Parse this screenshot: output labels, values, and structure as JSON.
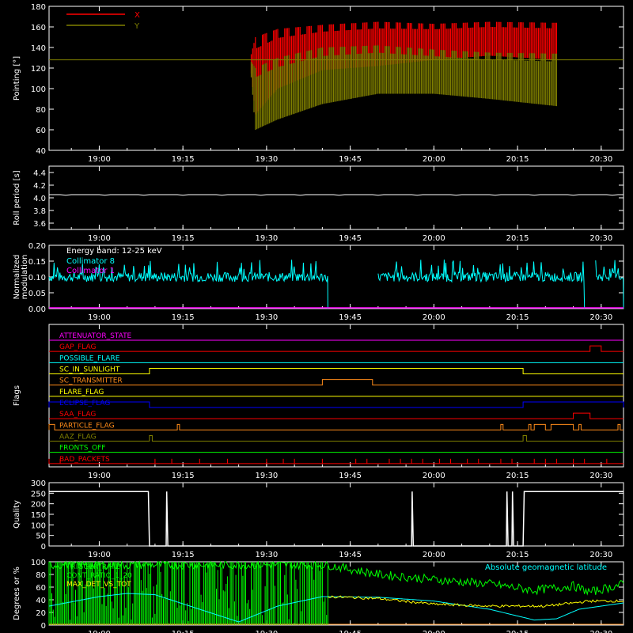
{
  "colors": {
    "bg": "#000000",
    "axis": "#ffffff",
    "red": "#ff0000",
    "olive": "#808000",
    "cyan": "#00ffff",
    "magenta": "#ff00ff",
    "orange": "#ff8c1a",
    "yellow": "#ffff00",
    "green": "#00ff00",
    "blue": "#0000ff",
    "white": "#ffffff"
  },
  "time_axis": {
    "min": "18:51",
    "max": "20:34",
    "ticks": [
      "19:00",
      "19:15",
      "19:30",
      "19:45",
      "20:00",
      "20:15",
      "20:30"
    ],
    "tick_minutes": [
      1140,
      1155,
      1170,
      1185,
      1200,
      1215,
      1230
    ],
    "range_minutes": [
      1131,
      1234
    ]
  },
  "chart_data": [
    {
      "type": "line",
      "ylabel": "Pointing [°]",
      "ylim": [
        40,
        180
      ],
      "yticks": [
        40,
        60,
        80,
        100,
        120,
        140,
        160,
        180
      ],
      "legend": [
        {
          "name": "X",
          "color": "red"
        },
        {
          "name": "Y",
          "color": "olive"
        }
      ],
      "series": [
        {
          "name": "X",
          "envelope_upper": [
            [
              1131,
              128
            ],
            [
              1167,
              128
            ],
            [
              1168,
              150
            ],
            [
              1172,
              158
            ],
            [
              1180,
              162
            ],
            [
              1190,
              165
            ],
            [
              1200,
              163
            ],
            [
              1210,
              165
            ],
            [
              1222,
              164
            ],
            [
              1222,
              128
            ],
            [
              1234,
              128
            ]
          ],
          "envelope_lower": [
            [
              1167,
              128
            ],
            [
              1168,
              75
            ],
            [
              1172,
              100
            ],
            [
              1180,
              118
            ],
            [
              1190,
              122
            ],
            [
              1200,
              128
            ],
            [
              1210,
              132
            ],
            [
              1222,
              128
            ]
          ]
        },
        {
          "name": "Y",
          "envelope_upper": [
            [
              1131,
              128
            ],
            [
              1167,
              128
            ],
            [
              1168,
              120
            ],
            [
              1172,
              130
            ],
            [
              1180,
              140
            ],
            [
              1190,
              142
            ],
            [
              1200,
              138
            ],
            [
              1210,
              135
            ],
            [
              1222,
              134
            ],
            [
              1222,
              128
            ],
            [
              1234,
              128
            ]
          ],
          "envelope_lower": [
            [
              1167,
              128
            ],
            [
              1168,
              60
            ],
            [
              1172,
              70
            ],
            [
              1180,
              85
            ],
            [
              1190,
              95
            ],
            [
              1200,
              95
            ],
            [
              1210,
              90
            ],
            [
              1222,
              83
            ]
          ]
        }
      ]
    },
    {
      "type": "line",
      "ylabel": "Roll period [s]",
      "ylim": [
        3.5,
        4.5
      ],
      "yticks": [
        3.6,
        3.8,
        4.0,
        4.2,
        4.4
      ],
      "series": [
        {
          "name": "",
          "values": [
            [
              1131,
              4.05
            ],
            [
              1234,
              4.05
            ]
          ]
        }
      ]
    },
    {
      "type": "line",
      "ylabel": "Normalized\nmodulation",
      "ylim": [
        0,
        0.2
      ],
      "yticks": [
        0.0,
        0.05,
        0.1,
        0.15,
        0.2
      ],
      "annotations": [
        "Energy band: 12-25 keV"
      ],
      "legend": [
        {
          "name": "Collimator 8",
          "color": "cyan"
        },
        {
          "name": "Collimator 1",
          "color": "magenta"
        }
      ],
      "series": [
        {
          "name": "Collimator 8",
          "segments": [
            [
              1131,
              1181
            ],
            [
              1190,
              1227
            ],
            [
              1229,
              1234
            ]
          ],
          "mean": 0.1
        },
        {
          "name": "Collimator 1",
          "values": [
            [
              1131,
              0.0
            ],
            [
              1234,
              0.0
            ]
          ]
        }
      ]
    },
    {
      "type": "line",
      "ylabel": "Flags",
      "series": [
        {
          "name": "ATTENUATOR_STATE",
          "color": "magenta",
          "on": []
        },
        {
          "name": "GAP_FLAG",
          "color": "red",
          "on": [
            [
              1228,
              1230
            ]
          ]
        },
        {
          "name": "POSSIBLE_FLARE",
          "color": "cyan",
          "on": []
        },
        {
          "name": "SC_IN_SUNLIGHT",
          "color": "yellow",
          "on": [
            [
              1149,
              1216
            ]
          ]
        },
        {
          "name": "SC_TRANSMITTER",
          "color": "orange",
          "on": [
            [
              1180,
              1189
            ]
          ]
        },
        {
          "name": "FLARE_FLAG",
          "color": "yellow",
          "on": []
        },
        {
          "name": "ECLIPSE_FLAG",
          "color": "blue",
          "on": [
            [
              1131,
              1149
            ],
            [
              1216,
              1234
            ]
          ]
        },
        {
          "name": "SAA_FLAG",
          "color": "red",
          "on": [
            [
              1225,
              1228
            ]
          ]
        },
        {
          "name": "PARTICLE_FLAG",
          "color": "orange",
          "on": [
            [
              1131,
              1132
            ],
            [
              1154,
              1154.4
            ],
            [
              1212,
              1212.4
            ],
            [
              1217,
              1217.4
            ],
            [
              1218,
              1220
            ],
            [
              1221,
              1225
            ],
            [
              1226,
              1226.4
            ],
            [
              1233,
              1233.4
            ]
          ]
        },
        {
          "name": "AAZ_FLAG",
          "color": "olive",
          "on": [
            [
              1149,
              1149.5
            ],
            [
              1216,
              1216.6
            ]
          ]
        },
        {
          "name": "FRONTS_OFF",
          "color": "green",
          "on": []
        },
        {
          "name": "BAD_PACKETS",
          "color": "red",
          "ticks": [
            1131,
            1133,
            1150,
            1153,
            1158,
            1163,
            1170,
            1173,
            1175,
            1180,
            1186,
            1188,
            1192,
            1194,
            1196,
            1198,
            1201,
            1203,
            1206,
            1208,
            1212,
            1214,
            1218,
            1220,
            1222,
            1225,
            1227,
            1231
          ]
        }
      ]
    },
    {
      "type": "line",
      "ylabel": "Quality",
      "ylim": [
        0,
        300
      ],
      "yticks": [
        0,
        50,
        100,
        150,
        200,
        250,
        300
      ],
      "series": [
        {
          "name": "Quality",
          "values": [
            [
              1131,
              258
            ],
            [
              1148.8,
              258
            ],
            [
              1149,
              0
            ],
            [
              1152,
              0
            ],
            [
              1152.1,
              258
            ],
            [
              1152.3,
              0
            ],
            [
              1196,
              0
            ],
            [
              1196.1,
              258
            ],
            [
              1196.3,
              0
            ],
            [
              1213,
              0
            ],
            [
              1213.1,
              258
            ],
            [
              1213.3,
              0
            ],
            [
              1214,
              0
            ],
            [
              1214.1,
              258
            ],
            [
              1214.3,
              0
            ],
            [
              1216,
              0
            ],
            [
              1216.2,
              258
            ],
            [
              1234,
              258
            ]
          ]
        }
      ]
    },
    {
      "type": "line",
      "ylabel": "Degrees or %",
      "ylim": [
        0,
        100
      ],
      "yticks": [
        0,
        20,
        40,
        60,
        80,
        100
      ],
      "legend": [
        {
          "name": "TRIGGER_RATE",
          "color": "green"
        },
        {
          "name": "CONT_RATIO_1_20",
          "color": "green"
        },
        {
          "name": "MAX_DET_VS_TOT",
          "color": "yellow"
        }
      ],
      "annotations": [
        "Absolute geomagnetic latitude"
      ],
      "series": [
        {
          "name": "Absolute geomagnetic latitude",
          "color": "cyan",
          "values": [
            [
              1131,
              30
            ],
            [
              1140,
              45
            ],
            [
              1145,
              50
            ],
            [
              1150,
              48
            ],
            [
              1158,
              25
            ],
            [
              1165,
              5
            ],
            [
              1172,
              30
            ],
            [
              1180,
              45
            ],
            [
              1190,
              44
            ],
            [
              1200,
              38
            ],
            [
              1210,
              25
            ],
            [
              1218,
              8
            ],
            [
              1222,
              10
            ],
            [
              1226,
              25
            ],
            [
              1234,
              35
            ]
          ]
        },
        {
          "name": "TRIGGER_RATE",
          "color": "green",
          "values": [
            [
              1131,
              95
            ],
            [
              1181,
              95
            ],
            [
              1190,
              80
            ],
            [
              1200,
              72
            ],
            [
              1210,
              65
            ],
            [
              1218,
              55
            ],
            [
              1225,
              62
            ],
            [
              1228,
              52
            ],
            [
              1234,
              65
            ]
          ]
        },
        {
          "name": "MAX_DET_VS_TOT",
          "color": "yellow",
          "values": [
            [
              1181,
              45
            ],
            [
              1190,
              42
            ],
            [
              1200,
              33
            ],
            [
              1210,
              30
            ],
            [
              1220,
              30
            ],
            [
              1228,
              38
            ],
            [
              1234,
              38
            ]
          ]
        }
      ]
    }
  ]
}
